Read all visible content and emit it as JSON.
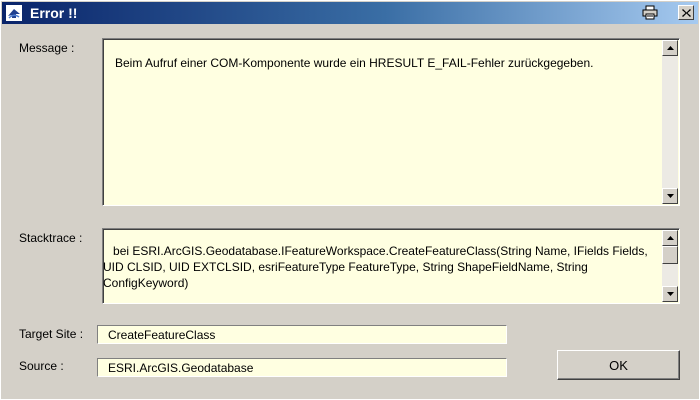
{
  "window": {
    "title": "Error !!",
    "colors": {
      "title_start": "#0a246a",
      "title_end": "#a6caf0",
      "face": "#d4d0c8",
      "field": "#ffffe1"
    }
  },
  "message": {
    "label": "Message :",
    "text": "Beim Aufruf einer COM-Komponente wurde ein HRESULT E_FAIL-Fehler zurückgegeben."
  },
  "stacktrace": {
    "label": "Stacktrace :",
    "text": "   bei ESRI.ArcGIS.Geodatabase.IFeatureWorkspace.CreateFeatureClass(String Name, IFields Fields, UID CLSID, UID EXTCLSID, esriFeatureType FeatureType, String ShapeFieldName, String ConfigKeyword)"
  },
  "target_site": {
    "label": "Target Site :",
    "value": "CreateFeatureClass"
  },
  "source": {
    "label": "Source :",
    "value": "ESRI.ArcGIS.Geodatabase"
  },
  "buttons": {
    "ok_label": "OK"
  },
  "icons": {
    "app": "app-icon",
    "print": "printer-icon",
    "close": "close-icon"
  }
}
